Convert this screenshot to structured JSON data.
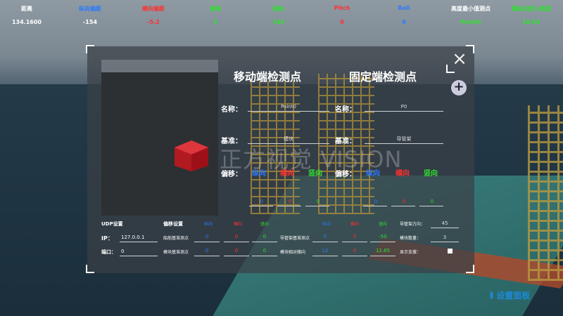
{
  "topbar": {
    "headers": [
      "距离",
      "纵向偏距",
      "横向偏距",
      "高差",
      "艏向",
      "Pitch",
      "Roll",
      "高度最小值测点",
      "横纵点距小高度"
    ],
    "values": [
      "134.1600",
      "-154",
      "-5.2",
      "5",
      "202",
      "0",
      "0",
      "Point0",
      "18.65"
    ],
    "colors": [
      "#ffffff",
      "#2a7aff",
      "#ff3030",
      "#30e030",
      "#30e030",
      "#ff3030",
      "#2a7aff",
      "#30e030",
      "#30e030"
    ]
  },
  "panel": {
    "close_icon": "×",
    "plus_icon": "+",
    "mobile_title": "移动端检测点",
    "fixed_title": "固定端检测点",
    "name_label": "名称：",
    "mobile_name": "Point0",
    "fixed_name": "P0",
    "datum_label": "基准：",
    "mobile_datum": "模块",
    "fixed_datum": "导管架",
    "offset_label": "偏移：",
    "axes": [
      "纵向",
      "横向",
      "竖向"
    ],
    "mobile_offsets": [
      "0",
      "0",
      "0"
    ],
    "fixed_offsets": [
      "0",
      "0",
      "0"
    ]
  },
  "udp": {
    "title": "UDP设置",
    "ip_label": "IP：",
    "ip_value": "127.0.0.1",
    "port_label": "端口：",
    "port_value": "0"
  },
  "offset_settings": {
    "title": "偏移设置",
    "axes": [
      "纵向",
      "横向",
      "竖向"
    ],
    "row1_label": "船舶基准测点",
    "row1": [
      "0",
      "0",
      "0"
    ],
    "row2_label": "模块基准测点",
    "row2": [
      "0",
      "0",
      "0"
    ],
    "row3_label": "导管架基准测点",
    "row3": [
      "0",
      "0",
      "-50"
    ],
    "row4_label": "模块相对艏向",
    "row4": [
      "12",
      "0",
      "12.65"
    ]
  },
  "right_settings": {
    "angle_label": "导管架方向：",
    "angle_value": "45",
    "count_label": "模块数量：",
    "count_value": "3",
    "support_label": "显示支撑：",
    "axes_repeat": [
      "纵向",
      "横向",
      "竖向"
    ]
  },
  "watermark": {
    "text": "正方视觉 VISION"
  },
  "footer": {
    "settings_label": "设置面板"
  }
}
